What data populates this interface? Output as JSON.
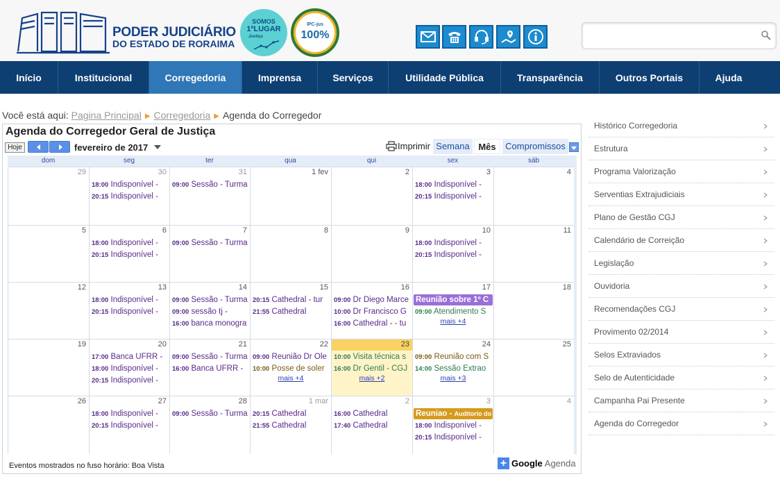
{
  "header": {
    "logo_line1": "PODER JUDICIÁRIO",
    "logo_line2": "DO ESTADO DE RORAIMA",
    "seal1": {
      "line1": "SOMOS",
      "line2": "1ºLUGAR",
      "line3": "Justiça"
    },
    "seal2": {
      "line1": "IPC-jus",
      "line2": "100%"
    },
    "icons": [
      "envelope-icon",
      "phone-icon",
      "headset-icon",
      "map-icon",
      "info-icon"
    ],
    "search_placeholder": ""
  },
  "nav": {
    "items": [
      {
        "label": "Início"
      },
      {
        "label": "Institucional"
      },
      {
        "label": "Corregedoria",
        "active": true
      },
      {
        "label": "Imprensa"
      },
      {
        "label": "Serviços"
      },
      {
        "label": "Utilidade Pública"
      },
      {
        "label": "Transparência"
      },
      {
        "label": "Outros Portais"
      },
      {
        "label": "Ajuda"
      }
    ]
  },
  "breadcrumb": {
    "prefix": "Você está aqui:",
    "links": [
      "Pagina Principal",
      "Corregedoria"
    ],
    "current": "Agenda do Corregedor"
  },
  "calendar": {
    "title": "Agenda do Corregedor Geral de Justiça",
    "today_label": "Hoje",
    "month": "fevereiro de 2017",
    "print_label": "Imprimir",
    "views": [
      "Semana",
      "Mês",
      "Compromissos"
    ],
    "active_view": "Mês",
    "weekdays": [
      "dom",
      "seg",
      "ter",
      "qua",
      "qui",
      "sex",
      "sáb"
    ],
    "timezone_note": "Eventos mostrados no fuso horário: Boa Vista",
    "google_g": "Google",
    "google_agenda": "Agenda",
    "colors": {
      "purple": "#5a2a8a",
      "green": "#2f7d4f",
      "olive": "#7a5b12",
      "bar_purple": "#9a6fd8",
      "bar_orange": "#d69a1c",
      "today": "#fad163"
    },
    "weeks": [
      [
        {
          "day": "29",
          "dim": true,
          "events": []
        },
        {
          "day": "30",
          "dim": true,
          "events": [
            {
              "time": "18:00",
              "title": "Indisponível - ",
              "color": "purple"
            },
            {
              "time": "20:15",
              "title": "Indisponível - ",
              "color": "purple"
            }
          ]
        },
        {
          "day": "31",
          "dim": true,
          "events": [
            {
              "time": "09:00",
              "title": "Sessão - Turma",
              "color": "purple"
            }
          ]
        },
        {
          "day": "1 fev",
          "events": []
        },
        {
          "day": "2",
          "events": []
        },
        {
          "day": "3",
          "events": [
            {
              "time": "18:00",
              "title": "Indisponível - ",
              "color": "purple"
            },
            {
              "time": "20:15",
              "title": "Indisponível - ",
              "color": "purple"
            }
          ]
        },
        {
          "day": "4",
          "events": []
        }
      ],
      [
        {
          "day": "5",
          "events": []
        },
        {
          "day": "6",
          "events": [
            {
              "time": "18:00",
              "title": "Indisponível - ",
              "color": "purple"
            },
            {
              "time": "20:15",
              "title": "Indisponível - ",
              "color": "purple"
            }
          ]
        },
        {
          "day": "7",
          "events": [
            {
              "time": "09:00",
              "title": "Sessão - Turma",
              "color": "purple"
            }
          ]
        },
        {
          "day": "8",
          "events": []
        },
        {
          "day": "9",
          "events": []
        },
        {
          "day": "10",
          "events": [
            {
              "time": "18:00",
              "title": "Indisponível - ",
              "color": "purple"
            },
            {
              "time": "20:15",
              "title": "Indisponível - ",
              "color": "purple"
            }
          ]
        },
        {
          "day": "11",
          "events": []
        }
      ],
      [
        {
          "day": "12",
          "events": []
        },
        {
          "day": "13",
          "events": [
            {
              "time": "18:00",
              "title": "Indisponível - ",
              "color": "purple"
            },
            {
              "time": "20:15",
              "title": "Indisponível - ",
              "color": "purple"
            }
          ]
        },
        {
          "day": "14",
          "events": [
            {
              "time": "09:00",
              "title": "Sessão - Turma",
              "color": "purple"
            },
            {
              "time": "09:00",
              "title": "sessão tj - ",
              "color": "purple"
            },
            {
              "time": "16:00",
              "title": "banca monogra",
              "color": "purple"
            }
          ]
        },
        {
          "day": "15",
          "events": [
            {
              "time": "20:15",
              "title": "Cathedral - tur",
              "color": "purple"
            },
            {
              "time": "21:55",
              "title": "Cathedral",
              "color": "purple"
            }
          ]
        },
        {
          "day": "16",
          "events": [
            {
              "time": "09:00",
              "title": "Dr Diego Marce",
              "color": "purple"
            },
            {
              "time": "10:00",
              "title": "Dr Francisco G",
              "color": "purple"
            },
            {
              "time": "16:00",
              "title": "Cathedral - - tu",
              "color": "purple"
            }
          ]
        },
        {
          "day": "17",
          "events": [
            {
              "bar": "Reunião sobre 1º C",
              "color": "bar_purple"
            },
            {
              "time": "09:00",
              "title": "Atendimento S",
              "color": "green"
            }
          ],
          "more": "mais +4"
        },
        {
          "day": "18",
          "events": []
        }
      ],
      [
        {
          "day": "19",
          "events": []
        },
        {
          "day": "20",
          "events": [
            {
              "time": "17:00",
              "title": "Banca UFRR - ",
              "color": "purple"
            },
            {
              "time": "18:00",
              "title": "Indisponível - ",
              "color": "purple"
            },
            {
              "time": "20:15",
              "title": "Indisponível - ",
              "color": "purple"
            }
          ]
        },
        {
          "day": "21",
          "events": [
            {
              "time": "09:00",
              "title": "Sessão - Turma",
              "color": "purple"
            },
            {
              "time": "16:00",
              "title": "Banca UFRR - ",
              "color": "purple"
            }
          ]
        },
        {
          "day": "22",
          "events": [
            {
              "time": "09:00",
              "title": "Reunião Dr Ole",
              "color": "purple"
            },
            {
              "time": "10:00",
              "title": "Posse de soler",
              "color": "olive"
            }
          ],
          "more": "mais +4"
        },
        {
          "day": "23",
          "today": true,
          "events": [
            {
              "time": "10:00",
              "title": "Visita técnica s",
              "color": "green"
            },
            {
              "time": "16:00",
              "title": "Dr Gentil - CGJ",
              "color": "green"
            }
          ],
          "more": "mais +2"
        },
        {
          "day": "24",
          "events": [
            {
              "time": "09:00",
              "title": "Reunião com S",
              "color": "olive"
            },
            {
              "time": "14:00",
              "title": "Sessão Extrao",
              "color": "green"
            }
          ],
          "more": "mais +3"
        },
        {
          "day": "25",
          "events": []
        }
      ],
      [
        {
          "day": "26",
          "events": []
        },
        {
          "day": "27",
          "events": [
            {
              "time": "18:00",
              "title": "Indisponível - ",
              "color": "purple"
            },
            {
              "time": "20:15",
              "title": "Indisponível - ",
              "color": "purple"
            }
          ]
        },
        {
          "day": "28",
          "events": [
            {
              "time": "09:00",
              "title": "Sessão - Turma",
              "color": "purple"
            }
          ]
        },
        {
          "day": "1 mar",
          "dim": true,
          "events": [
            {
              "time": "20:15",
              "title": "Cathedral",
              "color": "purple"
            },
            {
              "time": "21:55",
              "title": "Cathedral",
              "color": "purple"
            }
          ]
        },
        {
          "day": "2",
          "dim": true,
          "events": [
            {
              "time": "16:00",
              "title": "Cathedral",
              "color": "purple"
            },
            {
              "time": "17:40",
              "title": "Cathedral",
              "color": "purple"
            }
          ]
        },
        {
          "day": "3",
          "dim": true,
          "events": [
            {
              "bar": "Reuniao - ",
              "bar_small": "Auditorio do",
              "color": "bar_orange"
            },
            {
              "time": "18:00",
              "title": "Indisponível - ",
              "color": "purple"
            },
            {
              "time": "20:15",
              "title": "Indisponível - ",
              "color": "purple"
            }
          ]
        },
        {
          "day": "4",
          "dim": true,
          "events": []
        }
      ]
    ]
  },
  "sidebar": {
    "items": [
      "Histórico Corregedoria",
      "Estrutura",
      "Programa Valorização",
      "Serventias Extrajudiciais",
      "Plano de Gestão CGJ",
      "Calendário de Correição",
      "Legislação",
      "Ouvidoria",
      "Recomendações CGJ",
      "Provimento 02/2014",
      "Selos Extraviados",
      "Selo de Autenticidade",
      "Campanha Pai Presente",
      "Agenda do Corregedor"
    ]
  }
}
